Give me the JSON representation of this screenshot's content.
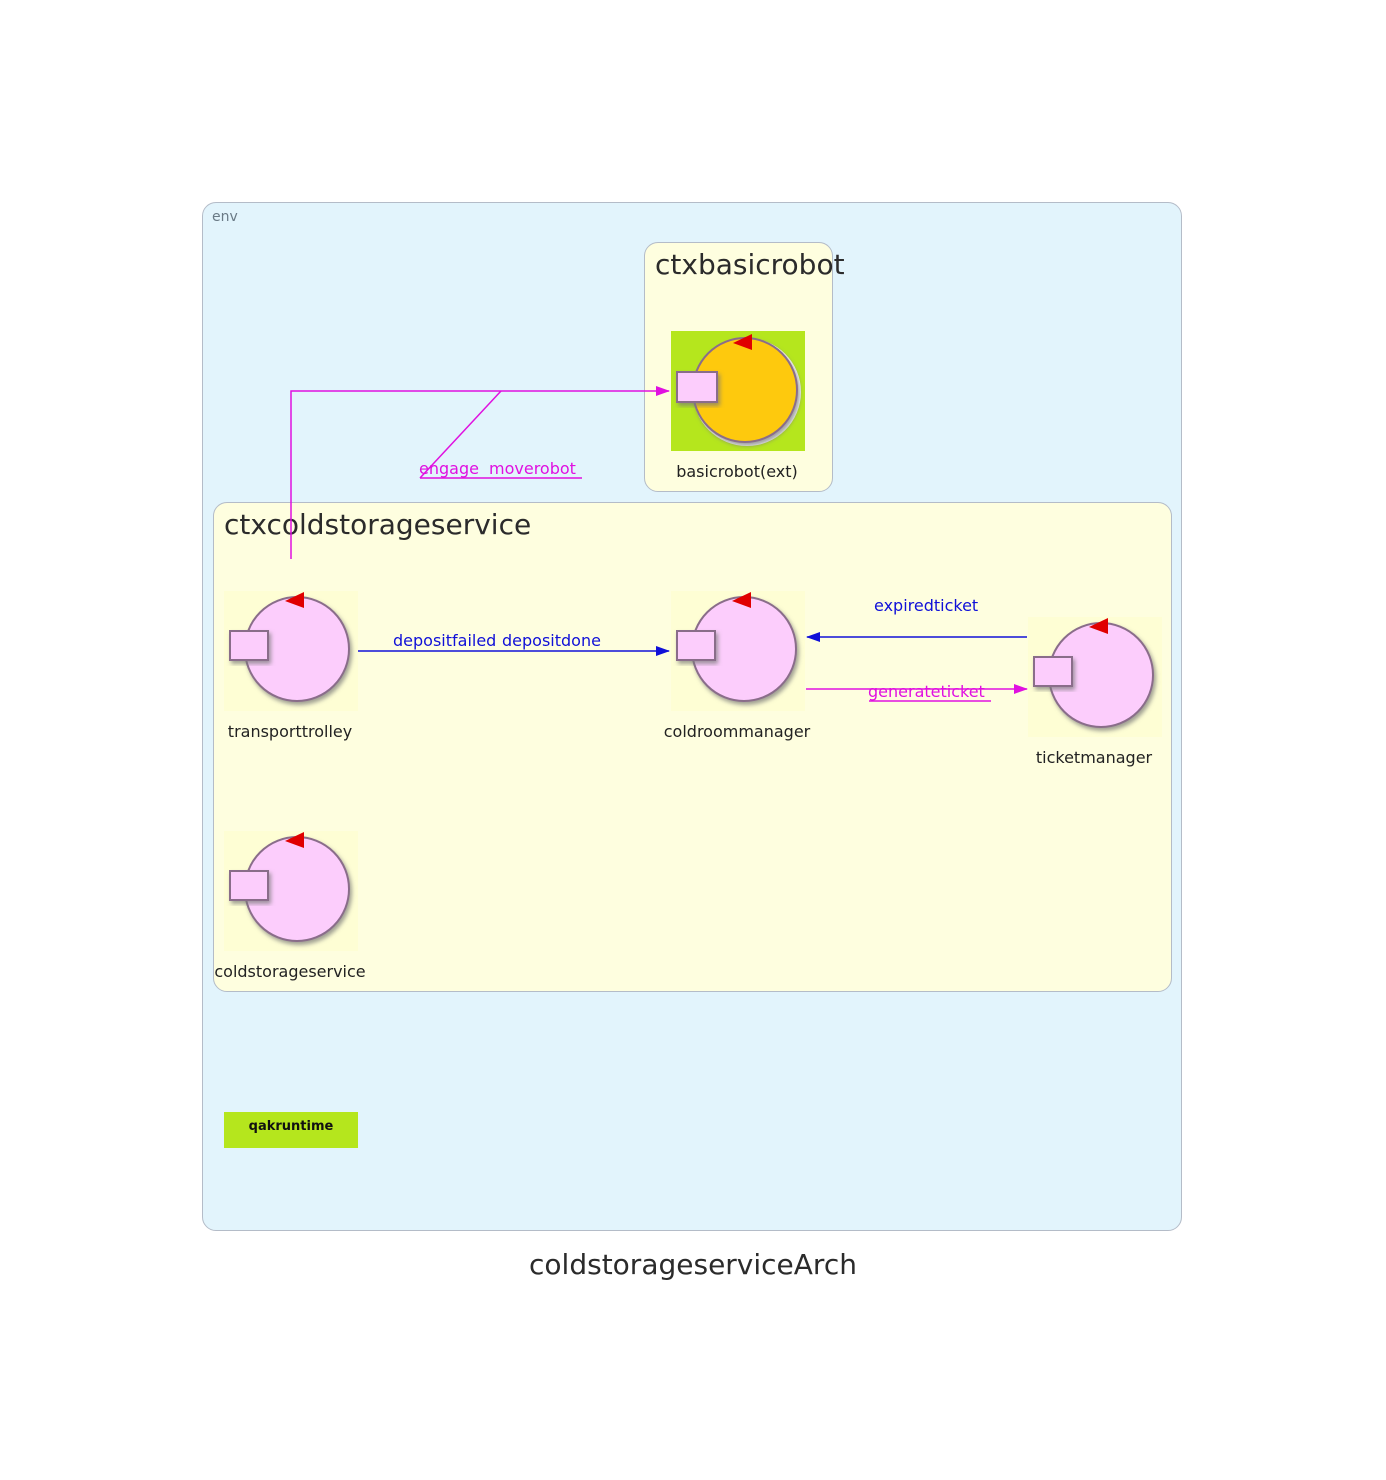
{
  "diagram": {
    "title": "coldstorageserviceArch",
    "env_label": "env",
    "contexts": {
      "basicrobot": {
        "title": "ctxbasicrobot"
      },
      "coldstorage": {
        "title": "ctxcoldstorageservice"
      }
    },
    "actors": {
      "basicrobot": "basicrobot(ext)",
      "transporttrolley": "transporttrolley",
      "coldroommanager": "coldroommanager",
      "ticketmanager": "ticketmanager",
      "coldstorageservice": "coldstorageservice"
    },
    "messages": {
      "engage": "engage",
      "moverobot": "moverobot",
      "depositfailed": "depositfailed",
      "depositdone": "depositdone",
      "expiredticket": "expiredticket",
      "generateticket": "generateticket"
    },
    "runtime_label": "qakruntime",
    "colors": {
      "request": "#e010e0",
      "dispatch": "#1010d8",
      "actor_fill": "#fccdfc",
      "external_fill": "#fec90f",
      "runtime": "#b5e61d"
    }
  }
}
